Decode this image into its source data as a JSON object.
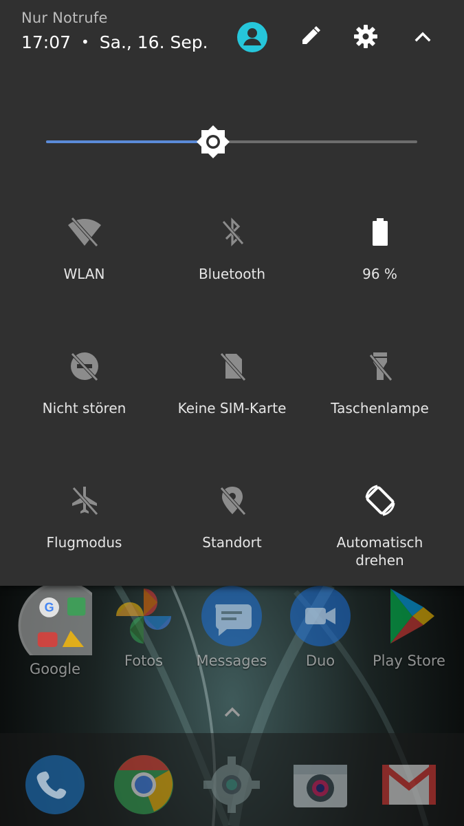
{
  "status": {
    "carrier": "Nur Notrufe",
    "time": "17:07",
    "separator": "•",
    "date": "Sa., 16. Sep."
  },
  "header_icons": [
    "account-icon",
    "edit-icon",
    "settings-icon",
    "collapse-icon"
  ],
  "brightness": {
    "level": 0.45
  },
  "tiles": [
    {
      "label": "WLAN",
      "icon": "wifi-off-icon",
      "active": false
    },
    {
      "label": "Bluetooth",
      "icon": "bluetooth-off-icon",
      "active": false
    },
    {
      "label": "96 %",
      "icon": "battery-icon",
      "active": true
    },
    {
      "label": "Nicht stören",
      "icon": "do-not-disturb-off-icon",
      "active": false
    },
    {
      "label": "Keine SIM-Karte",
      "icon": "no-sim-icon",
      "active": false
    },
    {
      "label": "Taschenlampe",
      "icon": "flashlight-off-icon",
      "active": false
    },
    {
      "label": "Flugmodus",
      "icon": "airplane-off-icon",
      "active": false
    },
    {
      "label": "Standort",
      "icon": "location-off-icon",
      "active": false
    },
    {
      "label": "Automatisch drehen",
      "icon": "auto-rotate-icon",
      "active": true
    }
  ],
  "home": {
    "apps": [
      {
        "label": "Google",
        "icon": "google-folder-icon"
      },
      {
        "label": "Fotos",
        "icon": "photos-icon"
      },
      {
        "label": "Messages",
        "icon": "messages-icon"
      },
      {
        "label": "Duo",
        "icon": "duo-icon"
      },
      {
        "label": "Play Store",
        "icon": "play-store-icon"
      }
    ],
    "dock": [
      {
        "icon": "phone-icon"
      },
      {
        "icon": "chrome-icon"
      },
      {
        "icon": "settings-app-icon"
      },
      {
        "icon": "camera-icon"
      },
      {
        "icon": "gmail-icon"
      }
    ]
  },
  "colors": {
    "panel": "#303030",
    "accent": "#5b8bd8",
    "account": "#26c6da",
    "icon_active": "#ffffff",
    "icon_inactive": "#8c8c8c"
  }
}
